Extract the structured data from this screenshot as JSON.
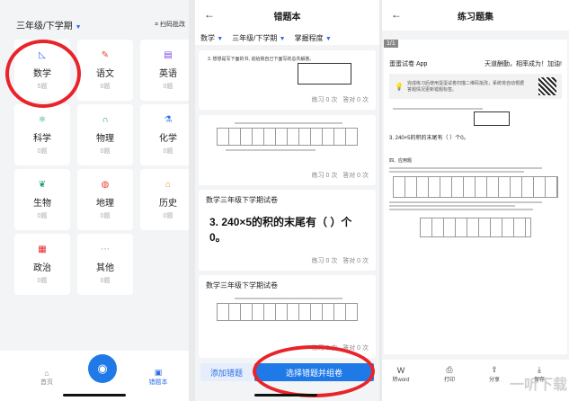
{
  "panel1": {
    "grade": "三年级/下学期",
    "scan": "扫码批改",
    "subjects": [
      {
        "name": "数学",
        "count": "5题",
        "icon": "triangle-ruler-icon",
        "color": "#2f6fe4"
      },
      {
        "name": "语文",
        "count": "0题",
        "icon": "pen-icon",
        "color": "#e8442a"
      },
      {
        "name": "英语",
        "count": "0题",
        "icon": "abc-book-icon",
        "color": "#7a4be0"
      },
      {
        "name": "科学",
        "count": "0题",
        "icon": "atom-icon",
        "color": "#1aa36a"
      },
      {
        "name": "物理",
        "count": "0题",
        "icon": "magnet-icon",
        "color": "#1aa36a"
      },
      {
        "name": "化学",
        "count": "0题",
        "icon": "flask-icon",
        "color": "#2f6fe4"
      },
      {
        "name": "生物",
        "count": "0题",
        "icon": "leaf-icon",
        "color": "#1aa36a"
      },
      {
        "name": "地理",
        "count": "0题",
        "icon": "globe-icon",
        "color": "#e8442a"
      },
      {
        "name": "历史",
        "count": "0题",
        "icon": "temple-icon",
        "color": "#e88a2a"
      },
      {
        "name": "政治",
        "count": "0题",
        "icon": "flag-icon",
        "color": "#e8242a"
      },
      {
        "name": "其他",
        "count": "0题",
        "icon": "dots-icon",
        "color": "#999999"
      }
    ],
    "tabs": {
      "home": "首页",
      "notebook": "错题本"
    }
  },
  "panel2": {
    "title": "错题本",
    "filters": [
      "数学",
      "三年级/下学期",
      "掌握程度"
    ],
    "card1_q": "3. 想想是写下面的书, 说给我自己下面写的总共解答。",
    "card1_stats": [
      "练习 0 次",
      "答对 0 次"
    ],
    "card2_stats": [
      "练习 0 次",
      "答对 0 次"
    ],
    "card3_title": "数学三年级下学期试卷",
    "card3_q": "3. 240×5的积的末尾有（    ）个0。",
    "card3_stats": [
      "练习 0 次",
      "答对 0 次"
    ],
    "card4_title": "数学三年级下学期试卷",
    "card4_stats": [
      "练习 0 次",
      "答对 0 次"
    ],
    "add_btn": "添加错题",
    "select_btn": "选择错题并组卷"
  },
  "panel3": {
    "title": "练习题集",
    "page": "1/1",
    "app": "蛋蛋试卷 App",
    "app_slogan": "天道酬勤，相率成为！加油!",
    "note": "完成练习后使用蛋蛋试卷扫描二维码批改，系统将自动根据答题情况更新错题标签。",
    "q3": "3. 240×5的积的末尾有（    ）个0。",
    "q4_head": "四、应用题",
    "tools": [
      {
        "label": "转word",
        "icon": "word-icon"
      },
      {
        "label": "打印",
        "icon": "printer-icon"
      },
      {
        "label": "分享",
        "icon": "share-icon"
      },
      {
        "label": "保存",
        "icon": "save-icon"
      }
    ],
    "watermark": "一听下载"
  },
  "colors": {
    "accent": "#1f7ae8",
    "highlight": "#e8242a"
  }
}
